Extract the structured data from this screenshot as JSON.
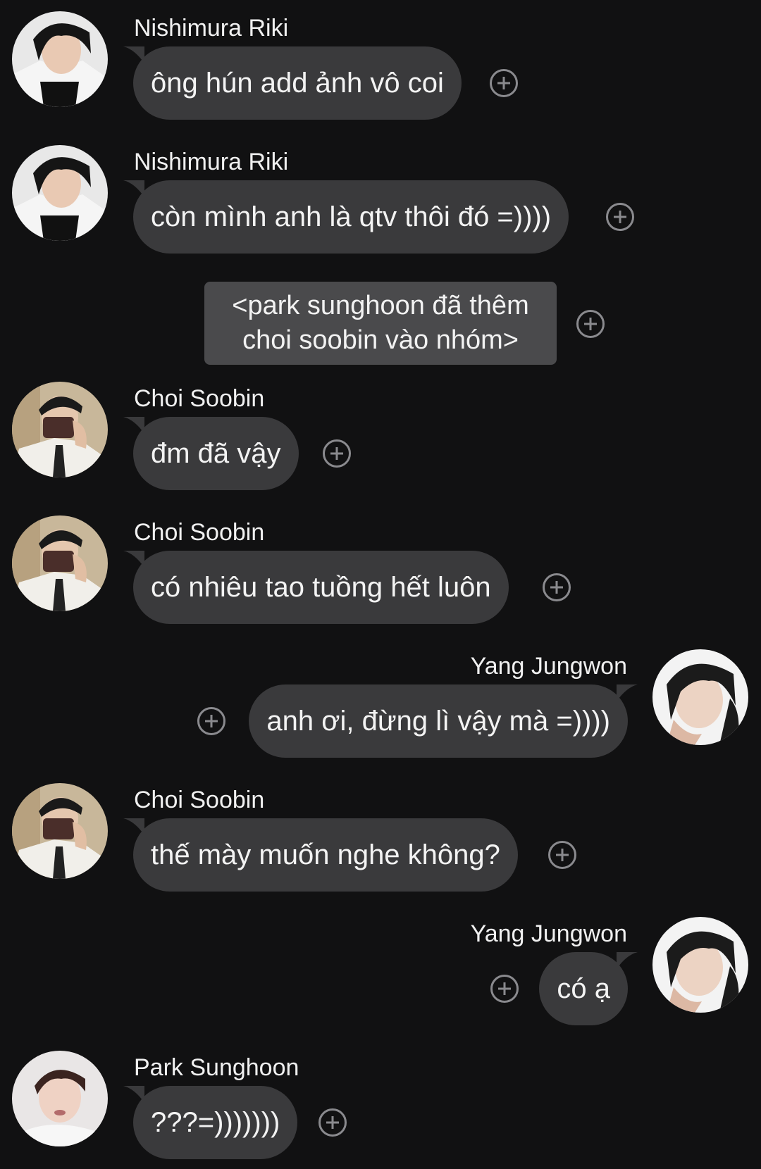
{
  "messages": [
    {
      "sender": "Nishimura Riki",
      "text": "ông hún add ảnh vô coi"
    },
    {
      "sender": "Nishimura Riki",
      "text": "còn mình anh là qtv thôi đó =))))"
    },
    {
      "sender": "Choi Soobin",
      "text": "đm đã vậy"
    },
    {
      "sender": "Choi Soobin",
      "text": "có nhiêu tao tuồng hết luôn"
    },
    {
      "sender": "Yang Jungwon",
      "text": "anh ơi, đừng lì vậy mà =))))"
    },
    {
      "sender": "Choi Soobin",
      "text": "thế mày muốn nghe không?"
    },
    {
      "sender": "Yang Jungwon",
      "text": "có ạ"
    },
    {
      "sender": "Park Sunghoon",
      "text": "???=)))))))"
    }
  ],
  "system_message": {
    "line1": "<park sunghoon đã thêm",
    "line2": "choi soobin vào nhóm>"
  },
  "icons": {
    "reaction": "add-reaction-icon"
  },
  "colors": {
    "background": "#111112",
    "bubble": "#3a3a3c",
    "system_bubble": "#4a4a4c",
    "reaction_icon": "#8a8a8e"
  }
}
